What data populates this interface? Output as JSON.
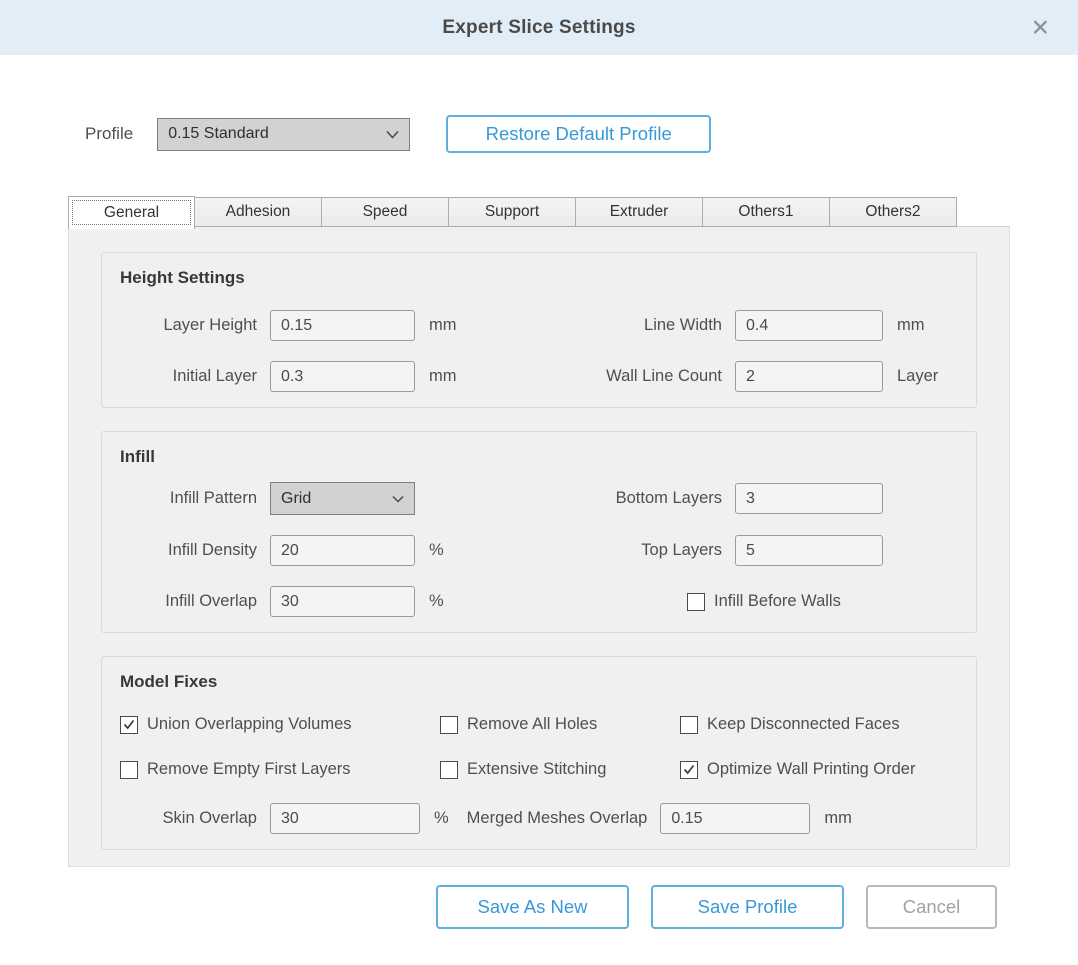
{
  "dialog": {
    "title": "Expert Slice Settings",
    "close_glyph": "✕"
  },
  "profile": {
    "label": "Profile",
    "value": "0.15 Standard",
    "restore_button": "Restore Default Profile"
  },
  "tabs": [
    {
      "label": "General",
      "active": true
    },
    {
      "label": "Adhesion",
      "active": false
    },
    {
      "label": "Speed",
      "active": false
    },
    {
      "label": "Support",
      "active": false
    },
    {
      "label": "Extruder",
      "active": false
    },
    {
      "label": "Others1",
      "active": false
    },
    {
      "label": "Others2",
      "active": false
    }
  ],
  "sections": {
    "height_settings": {
      "title": "Height Settings",
      "layer_height": {
        "label": "Layer Height",
        "value": "0.15",
        "unit": "mm"
      },
      "initial_layer": {
        "label": "Initial Layer",
        "value": "0.3",
        "unit": "mm"
      },
      "line_width": {
        "label": "Line Width",
        "value": "0.4",
        "unit": "mm"
      },
      "wall_line_count": {
        "label": "Wall Line Count",
        "value": "2",
        "unit": "Layer"
      }
    },
    "infill": {
      "title": "Infill",
      "pattern": {
        "label": "Infill Pattern",
        "value": "Grid"
      },
      "density": {
        "label": "Infill Density",
        "value": "20",
        "unit": "%"
      },
      "overlap": {
        "label": "Infill Overlap",
        "value": "30",
        "unit": "%"
      },
      "bottom_layers": {
        "label": "Bottom Layers",
        "value": "3"
      },
      "top_layers": {
        "label": "Top Layers",
        "value": "5"
      },
      "infill_before_walls": {
        "label": "Infill Before Walls",
        "checked": false
      }
    },
    "model_fixes": {
      "title": "Model Fixes",
      "checkboxes": [
        {
          "label": "Union Overlapping Volumes",
          "checked": true
        },
        {
          "label": "Remove All Holes",
          "checked": false
        },
        {
          "label": "Keep Disconnected Faces",
          "checked": false
        },
        {
          "label": "Remove Empty First Layers",
          "checked": false
        },
        {
          "label": "Extensive Stitching",
          "checked": false
        },
        {
          "label": "Optimize Wall Printing Order",
          "checked": true
        }
      ],
      "skin_overlap": {
        "label": "Skin Overlap",
        "value": "30",
        "unit": "%"
      },
      "merged_meshes_overlap": {
        "label": "Merged Meshes Overlap",
        "value": "0.15",
        "unit": "mm"
      }
    }
  },
  "footer": {
    "save_as_new": "Save As New",
    "save_profile": "Save Profile",
    "cancel": "Cancel"
  },
  "colors": {
    "titlebar_bg": "#e1edf7",
    "accent_blue": "#3898d8",
    "accent_border": "#5fafe0",
    "panel_bg": "#f0f0f0",
    "dropdown_bg": "#d2d2d2",
    "disabled_grey": "#a2a2a2"
  }
}
